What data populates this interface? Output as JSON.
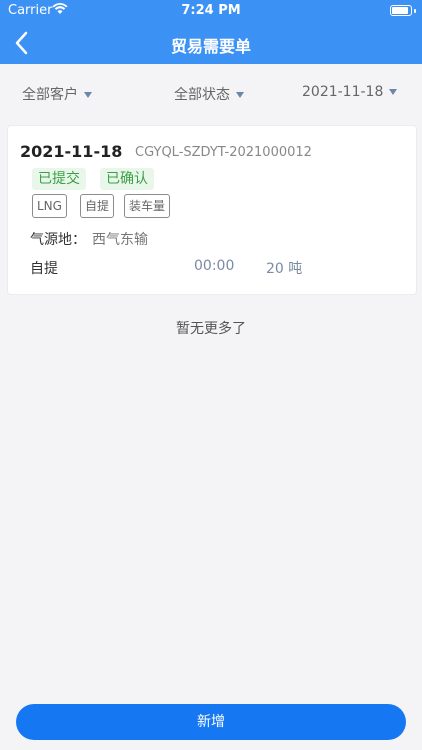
{
  "status_bar": {
    "carrier": "Carrier",
    "time": "7:24 PM"
  },
  "header": {
    "title": "贸易需要单"
  },
  "filters": [
    {
      "label": "全部客户"
    },
    {
      "label": "全部状态"
    },
    {
      "label": "2021-11-18"
    }
  ],
  "order": {
    "date": "2021-11-18",
    "code": "CGYQL-SZDYT-2021000012",
    "statuses": [
      "已提交",
      "已确认"
    ],
    "tags": [
      "LNG",
      "自提",
      "装车量"
    ],
    "origin_label": "气源地：",
    "origin_value": "西气东输",
    "pickup_label": "自提",
    "time": "00:00",
    "quantity": "20 吨"
  },
  "list": {
    "no_more": "暂无更多了"
  },
  "actions": {
    "add_label": "新增"
  },
  "colors": {
    "header": "#3c92f4",
    "primary_button": "#1677f2",
    "status_bg": "#e9f7ea",
    "status_text": "#3b9f48"
  }
}
